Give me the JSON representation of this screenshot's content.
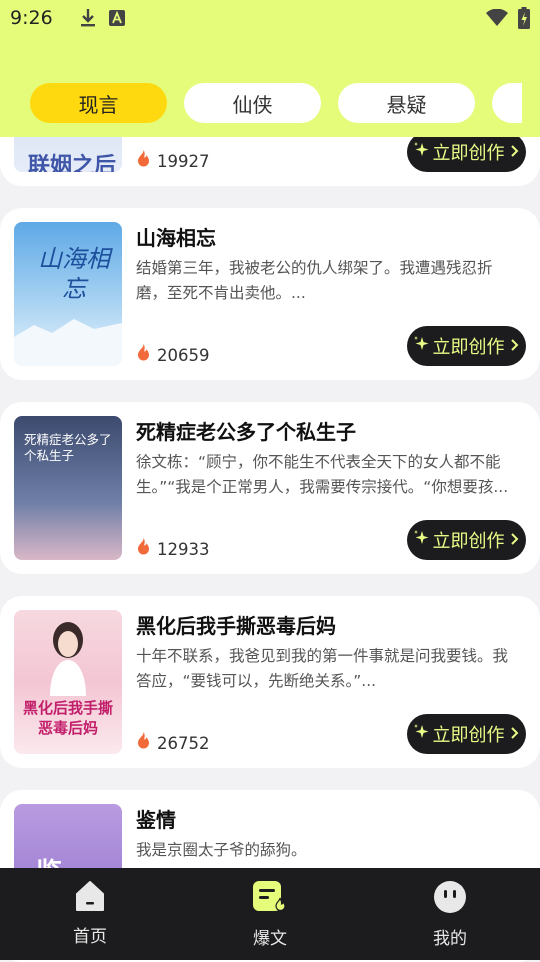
{
  "status_bar": {
    "time": "9:26"
  },
  "tabs": [
    {
      "label": "现言",
      "active": true
    },
    {
      "label": "仙侠",
      "active": false
    },
    {
      "label": "悬疑",
      "active": false
    },
    {
      "label": "",
      "active": false
    }
  ],
  "cards": [
    {
      "cover_text": "联姻之后",
      "title": "",
      "description": "",
      "count": "19927",
      "button_label": "立即创作"
    },
    {
      "cover_text": "山海相忘",
      "title": "山海相忘",
      "description": "结婚第三年，我被老公的仇人绑架了。我遭遇残忍折磨，至死不肯出卖他。...",
      "count": "20659",
      "button_label": "立即创作"
    },
    {
      "cover_text": "死精症老公多了个私生子",
      "title": "死精症老公多了个私生子",
      "description": "徐文栋：“顾宁，你不能生不代表全天下的女人都不能生。”“我是个正常男人，我需要传宗接代。“你想要孩...",
      "count": "12933",
      "button_label": "立即创作"
    },
    {
      "cover_text": "黑化后我手撕恶毒后妈",
      "title": "黑化后我手撕恶毒后妈",
      "description": "十年不联系，我爸见到我的第一件事就是问我要钱。我答应，“要钱可以，先断绝关系。”...",
      "count": "26752",
      "button_label": "立即创作"
    },
    {
      "cover_text": "鉴",
      "title": "鉴情",
      "description": "我是京圈太子爷的舔狗。",
      "count": "",
      "button_label": ""
    }
  ],
  "bottom_nav": [
    {
      "label": "首页",
      "icon": "home-icon"
    },
    {
      "label": "爆文",
      "icon": "hot-article-icon",
      "active": true
    },
    {
      "label": "我的",
      "icon": "profile-icon"
    }
  ],
  "colors": {
    "accent_lime": "#e5fb7a",
    "tab_active": "#ffd90f",
    "dark": "#1c1c1e",
    "fire": "#f26a3a"
  }
}
